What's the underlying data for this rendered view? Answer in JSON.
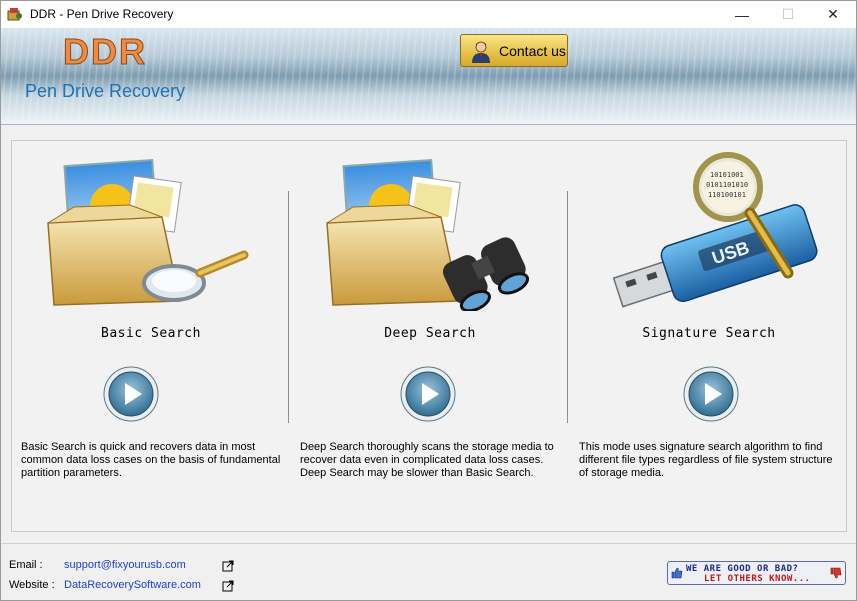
{
  "window": {
    "title": "DDR - Pen Drive Recovery",
    "min_glyph": "—",
    "max_glyph": "☐",
    "close_glyph": "✕"
  },
  "header": {
    "logo": "DDR",
    "subtitle": "Pen Drive Recovery",
    "contact_label": "Contact us"
  },
  "modes": [
    {
      "heading": "Basic Search",
      "icon": "folder-magnifier-icon",
      "description": "Basic Search is quick and recovers data in most common data loss cases on the basis of fundamental partition parameters."
    },
    {
      "heading": "Deep Search",
      "icon": "folder-binoculars-icon",
      "description": "Deep Search thoroughly scans the storage media to recover data even in complicated data loss cases. Deep Search may be slower than Basic Search."
    },
    {
      "heading": "Signature Search",
      "icon": "usb-magnifier-icon",
      "description": "This mode uses signature search algorithm to find different file types regardless of file system structure of storage media."
    }
  ],
  "footer": {
    "email_label": "Email :",
    "email_value": "support@fixyourusb.com",
    "website_label": "Website :",
    "website_value": "DataRecoverySoftware.com",
    "feedback_line1": "WE ARE GOOD OR BAD?",
    "feedback_line2": "LET OTHERS KNOW..."
  },
  "colors": {
    "accent_blue": "#1d72b8",
    "logo_orange": "#f08a3e",
    "link_blue": "#1f3fd0",
    "contact_gold": "#e7c24b"
  }
}
